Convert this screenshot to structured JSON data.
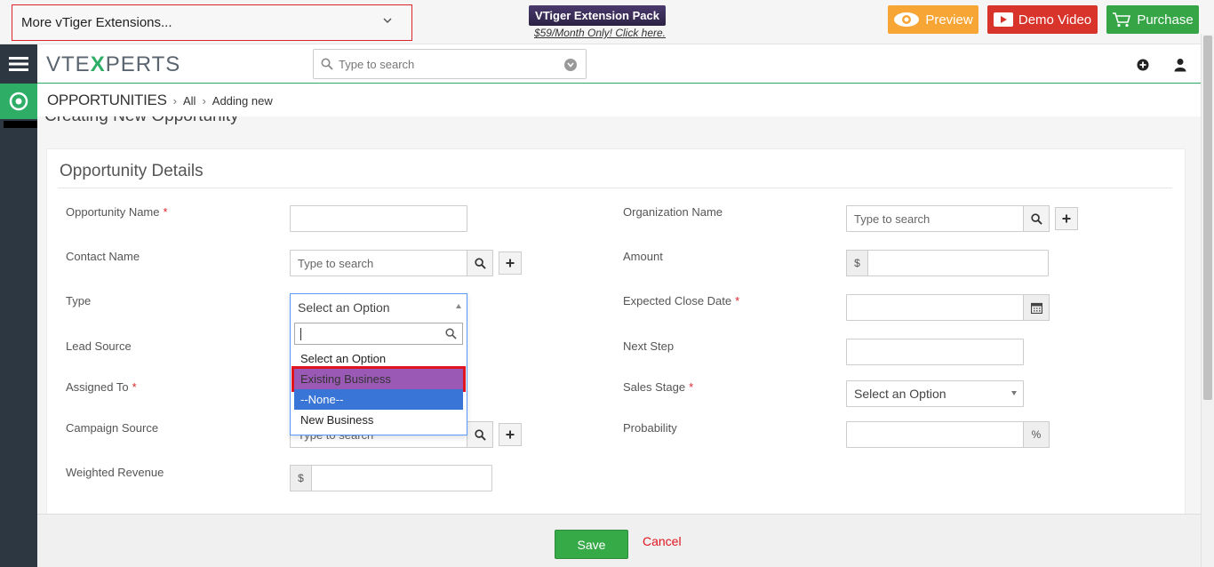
{
  "promo": {
    "extensions_select": "More vTiger Extensions...",
    "pack_badge": "VTiger Extension Pack",
    "pack_link": "$59/Month Only! Click here.",
    "preview": "Preview",
    "demo_video": "Demo Video",
    "purchase": "Purchase"
  },
  "header": {
    "logo_left": "VTE",
    "logo_x": "X",
    "logo_right": "PERTS",
    "search_placeholder": "Type to search"
  },
  "breadcrumb": {
    "module": "OPPORTUNITIES",
    "all": "All",
    "current": "Adding new"
  },
  "page": {
    "heading": "Creating New Opportunity"
  },
  "panel": {
    "title": "Opportunity Details",
    "fields": {
      "opportunity_name": "Opportunity Name",
      "organization_name": "Organization Name",
      "contact_name": "Contact Name",
      "amount": "Amount",
      "type": "Type",
      "expected_close_date": "Expected Close Date",
      "lead_source": "Lead Source",
      "next_step": "Next Step",
      "assigned_to": "Assigned To",
      "sales_stage": "Sales Stage",
      "campaign_source": "Campaign Source",
      "probability": "Probability",
      "weighted_revenue": "Weighted Revenue"
    },
    "required_mark": "*",
    "search_placeholder": "Type to search",
    "select_placeholder": "Select an Option",
    "currency": "$",
    "percent": "%"
  },
  "type_dropdown": {
    "selected": "Select an Option",
    "options": [
      "Select an Option",
      "Existing Business",
      "--None--",
      "New Business"
    ]
  },
  "footer": {
    "save": "Save",
    "cancel": "Cancel"
  },
  "colors": {
    "accent_green": "#2dad66",
    "sidebar": "#2c3742",
    "highlight_blue": "#3875d7",
    "selected_purple": "#9b59b6",
    "annotation_red": "#e0141e"
  }
}
